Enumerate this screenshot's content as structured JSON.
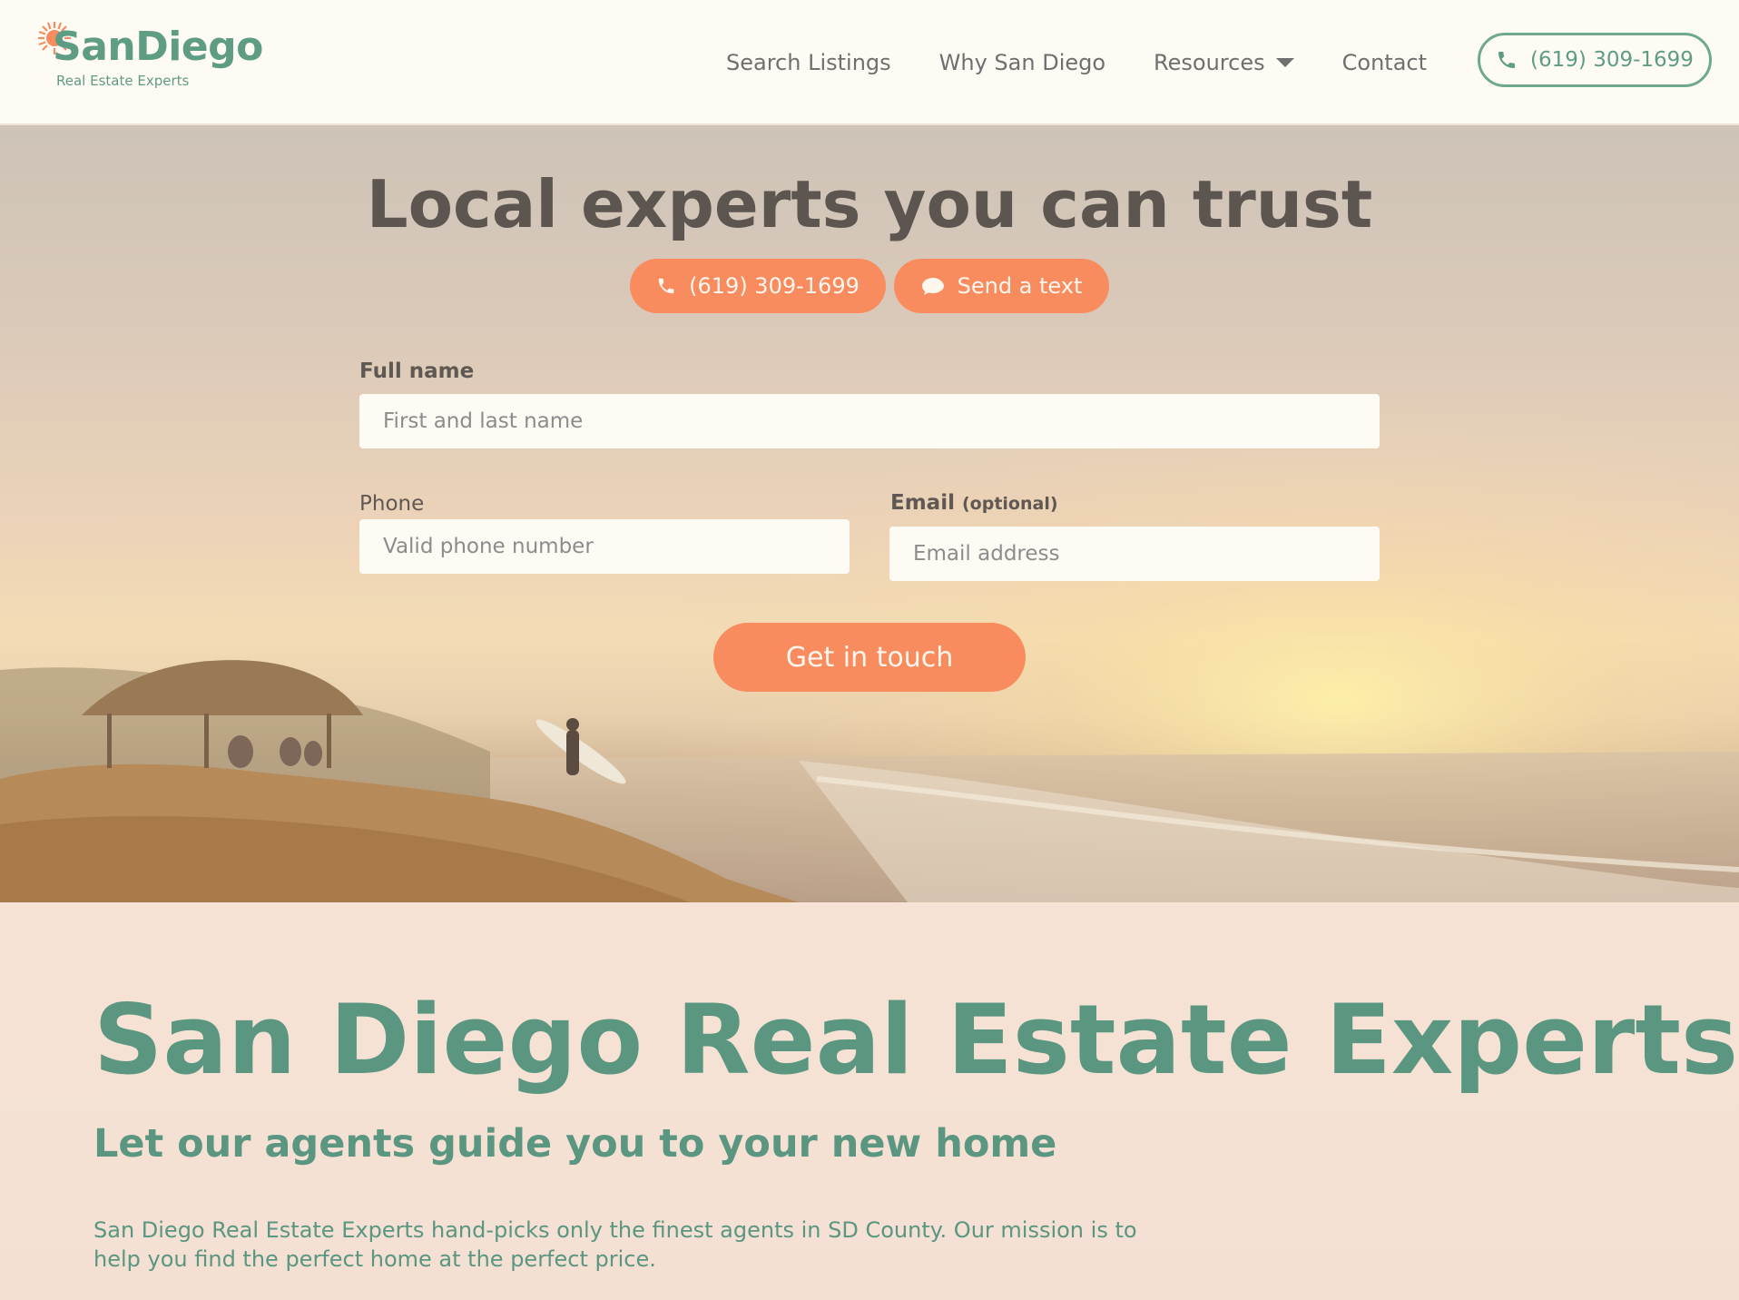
{
  "brand": {
    "logo_main": "SanDiego",
    "logo_sub": "Real Estate Experts",
    "primary_color": "#5e9c83",
    "accent_color": "#f98c5e"
  },
  "nav": {
    "items": [
      {
        "label": "Search Listings"
      },
      {
        "label": "Why San Diego"
      },
      {
        "label": "Resources",
        "has_dropdown": true
      },
      {
        "label": "Contact"
      }
    ],
    "phone": "(619) 309-1699",
    "phone_icon": "phone-icon"
  },
  "hero": {
    "title": "Local experts you can trust",
    "call_button": "(619) 309-1699",
    "text_button": "Send a text",
    "form": {
      "full_name_label": "Full name",
      "full_name_placeholder": "First and last name",
      "phone_label": "Phone",
      "phone_placeholder": "Valid phone number",
      "email_label": "Email",
      "email_optional": "(optional)",
      "email_placeholder": "Email address",
      "submit_label": "Get in touch"
    }
  },
  "about": {
    "title": "San Diego Real Estate Experts",
    "subtitle": "Let our agents guide you to your new home",
    "body": "San Diego Real Estate Experts hand-picks only the finest agents in SD County. Our mission is to help you find the perfect home at the perfect price."
  }
}
